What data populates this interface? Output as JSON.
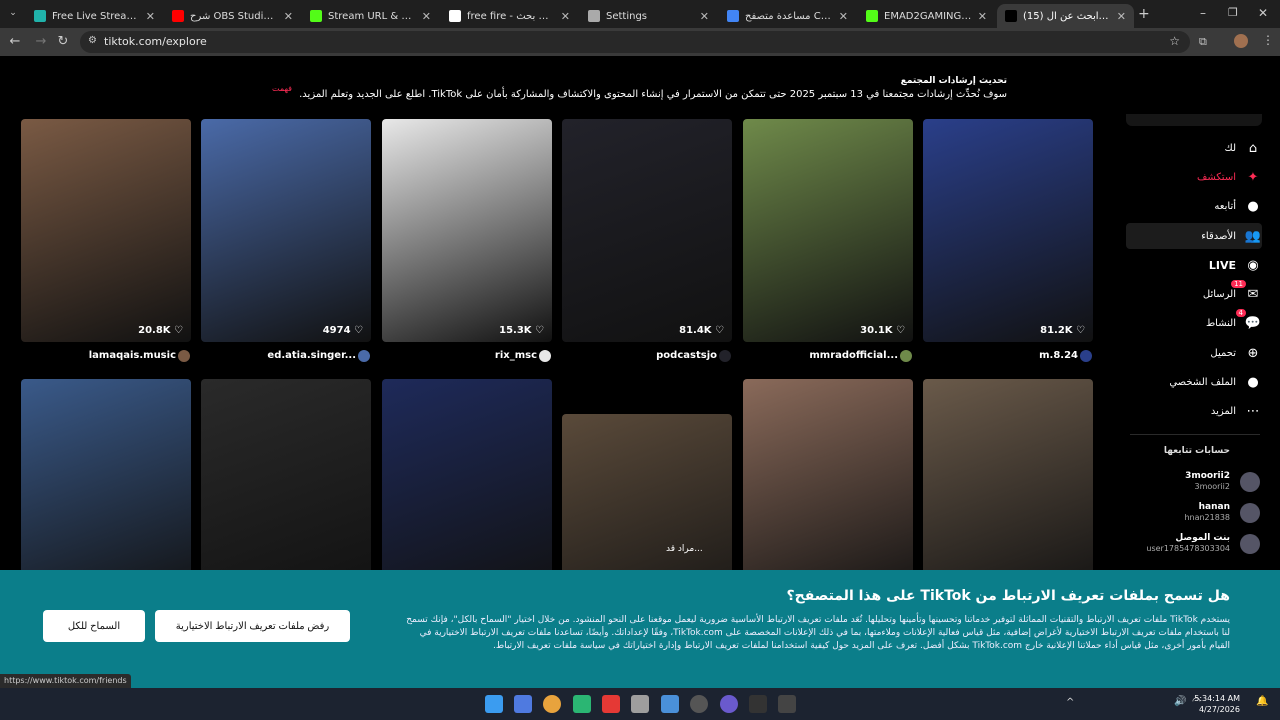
{
  "tabs": [
    {
      "title": "Free Live Streaming & Re",
      "color": "#20b2aa"
    },
    {
      "title": "شرح OBS Studio 2025 لت",
      "color": "#ff0000"
    },
    {
      "title": "Stream URL & Key - Kick",
      "color": "#53fc18"
    },
    {
      "title": "free fire - بحث Google",
      "color": "#ffffff"
    },
    {
      "title": "Settings",
      "color": "#aaaaaa"
    },
    {
      "title": "مساعدة متصفح Chrome",
      "color": "#4285f4"
    },
    {
      "title": "EMAD2GAMING Stream",
      "color": "#53fc18"
    },
    {
      "title": "(15) استكشف - ابحث عن ال",
      "color": "#000000"
    }
  ],
  "toolbar": {
    "url": "tiktok.com/explore"
  },
  "banner": {
    "title": "تحديث إرشادات المجتمع",
    "text": "سوف نُحدِّث إرشادات مجتمعنا في 13 سبتمبر 2025 حتى تتمكن من الاستمرار في إنشاء المحتوى والاكتشاف والمشاركة بأمان على TikTok. اطلع على الجديد وتعلم المزيد.",
    "dismiss": "فهمت"
  },
  "videos_row1": [
    {
      "likes": "20.8K",
      "user": "lamaqais.music",
      "color": "#7a5a44"
    },
    {
      "likes": "4974",
      "user": "ed.atia.singer...",
      "color": "#4a6aa8"
    },
    {
      "likes": "15.3K",
      "user": "rix_msc",
      "color": "#e8e8e8"
    },
    {
      "likes": "81.4K",
      "user": "podcastsjo",
      "color": "#22222a"
    },
    {
      "likes": "30.1K",
      "user": "mmradofficial...",
      "color": "#6f8a4a"
    },
    {
      "likes": "81.2K",
      "user": "m.8.24",
      "color": "#2a3f8a"
    }
  ],
  "videos_row2": [
    {
      "color": "#3a5a8a"
    },
    {
      "color": "#2a2a2a"
    },
    {
      "color": "#1e2a5a"
    },
    {
      "color": "#5a4a3a",
      "overlay": "مراد قد..."
    },
    {
      "color": "#8a6a5a"
    },
    {
      "color": "#6a5a4a"
    }
  ],
  "sidebar": {
    "items": [
      {
        "label": "لك",
        "icon": "⌂",
        "name": "home"
      },
      {
        "label": "استكشف",
        "icon": "✦",
        "name": "explore",
        "selected": true
      },
      {
        "label": "أتابعه",
        "icon": "●",
        "name": "following"
      },
      {
        "label": "الأصدقاء",
        "icon": "👥",
        "name": "friends"
      },
      {
        "label": "LIVE",
        "icon": "◉",
        "name": "live"
      },
      {
        "label": "الرسائل",
        "icon": "✉",
        "name": "messages",
        "badge": "11"
      },
      {
        "label": "النشاط",
        "icon": "💬",
        "name": "activity",
        "badge": "4"
      },
      {
        "label": "تحميل",
        "icon": "⊕",
        "name": "upload"
      },
      {
        "label": "الملف الشخصي",
        "icon": "●",
        "name": "profile"
      },
      {
        "label": "المزيد",
        "icon": "⋯",
        "name": "more"
      }
    ],
    "following_title": "حسابات تتابعها",
    "following": [
      {
        "name": "3moorii2",
        "handle": "3moorii2"
      },
      {
        "name": "hanan",
        "handle": "hnan21838"
      },
      {
        "name": "بنت الموصل",
        "handle": "user1785478303304"
      }
    ]
  },
  "cookie": {
    "title": "هل تسمح بملفات تعريف الارتباط من TikTok على هذا المتصفح؟",
    "body": "يستخدم TikTok ملفات تعريف الارتباط والتقنيات المماثلة لتوفير خدماتنا وتحسينها وتأمينها وتحليلها. تُعَد ملفات تعريف الارتباط الأساسية ضرورية ليعمل موقعنا على النحو المنشود. من خلال اختيار \"السماح بالكل\"، فإنك تسمح لنا باستخدام ملفات تعريف الارتباط الاختيارية لأغراض إضافية، مثل قياس فعالية الإعلانات وملاءمتها، بما في ذلك الإعلانات المخصصة على TikTok.com، وفقًا لإعداداتك. وأيضًا، تساعدنا ملفات تعريف الارتباط الاختيارية في القيام بأمور أخرى، مثل قياس أداء حملاتنا الإعلانية خارج TikTok.com بشكل أفضل. تعرف على المزيد حول كيفية استخدامنا لملفات تعريف الارتباط وإدارة اختياراتك في سياسة ملفات تعريف الارتباط.",
    "reject": "رفض ملفات تعريف الارتباط الاختيارية",
    "allow": "السماح للكل"
  },
  "status_url": "https://www.tiktok.com/friends",
  "clock": {
    "time": "5:34:14 AM",
    "date": "4/27/2026"
  },
  "colors": {
    "accent": "#fe2c55",
    "cookie_bg": "#0b7e8a"
  }
}
